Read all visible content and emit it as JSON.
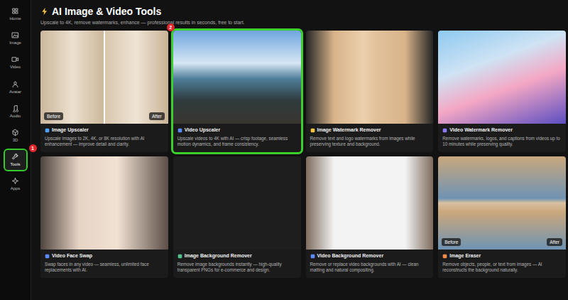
{
  "header": {
    "title": "AI Image & Video Tools",
    "subtitle": "Upscale to 4K, remove watermarks, enhance — professional results in seconds, free to start."
  },
  "sidebar": {
    "items": [
      {
        "label": "Home",
        "selected": false,
        "highlighted": false
      },
      {
        "label": "Image",
        "selected": false,
        "highlighted": false
      },
      {
        "label": "Video",
        "selected": false,
        "highlighted": false
      },
      {
        "label": "Avatar",
        "selected": false,
        "highlighted": false
      },
      {
        "label": "Audio",
        "selected": false,
        "highlighted": false
      },
      {
        "label": "3D",
        "selected": false,
        "highlighted": false
      },
      {
        "label": "Tools",
        "selected": true,
        "highlighted": true,
        "badge": "1"
      },
      {
        "label": "Apps",
        "selected": false,
        "highlighted": false
      }
    ]
  },
  "cards": [
    {
      "title": "Image Upscaler",
      "description": "Upscale images to 2K, 4K, or 8K resolution with AI enhancement — improve detail and clarity.",
      "labels": [
        "Before",
        "After"
      ],
      "highlighted": false
    },
    {
      "title": "Video Upscaler",
      "description": "Upscale videos to 4K with AI — crisp footage, seamless motion dynamics, and frame consistency.",
      "labels": [],
      "highlighted": true,
      "badge": "2"
    },
    {
      "title": "Image Watermark Remover",
      "description": "Remove text and logo watermarks from images while preserving texture and background.",
      "labels": [],
      "highlighted": false
    },
    {
      "title": "Video Watermark Remover",
      "description": "Remove watermarks, logos, and captions from videos up to 10 minutes while preserving quality.",
      "labels": [],
      "highlighted": false
    },
    {
      "title": "Video Face Swap",
      "description": "Swap faces in any video — seamless, unlimited face replacements with AI.",
      "labels": [],
      "highlighted": false
    },
    {
      "title": "Image Background Remover",
      "description": "Remove image backgrounds instantly — high-quality transparent PNGs for e-commerce and design.",
      "labels": [],
      "highlighted": false
    },
    {
      "title": "Video Background Remover",
      "description": "Remove or replace video backgrounds with AI — clean matting and natural compositing.",
      "labels": [],
      "highlighted": false
    },
    {
      "title": "Image Eraser",
      "description": "Remove objects, people, or text from images — AI reconstructs the background naturally.",
      "labels": [
        "Before",
        "After"
      ],
      "highlighted": false
    }
  ]
}
